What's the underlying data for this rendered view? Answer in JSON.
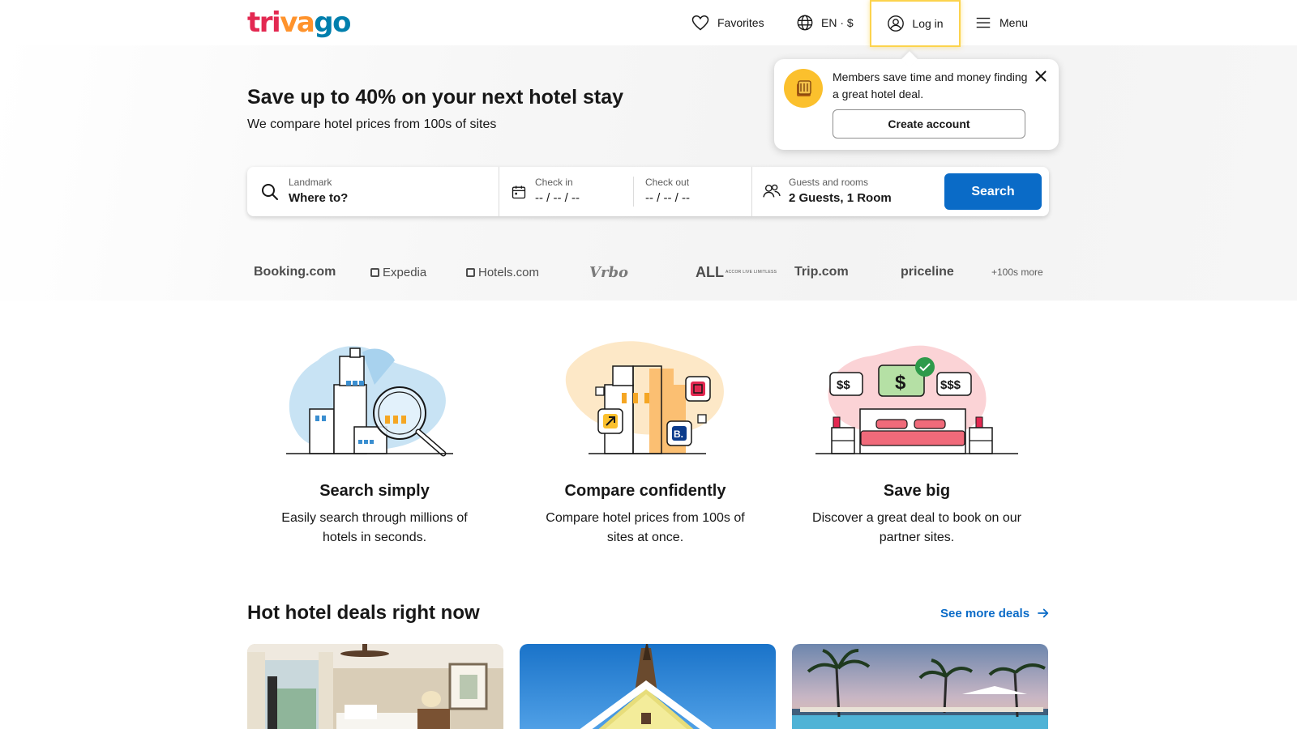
{
  "header": {
    "logo": {
      "part1": "tri",
      "part2": "va",
      "part3": "go"
    },
    "favorites_label": "Favorites",
    "language_label": "EN · $",
    "login_label": "Log in",
    "menu_label": "Menu"
  },
  "popover": {
    "message": "Members save time and money finding a great hotel deal.",
    "create_account_label": "Create account"
  },
  "hero": {
    "title": "Save up to 40% on your next hotel stay",
    "subtitle": "We compare hotel prices from 100s of sites"
  },
  "search": {
    "destination_label": "Landmark",
    "destination_placeholder": "Where to?",
    "checkin_label": "Check in",
    "checkin_value": "-- / -- / --",
    "checkout_label": "Check out",
    "checkout_value": "-- / -- / --",
    "guests_label": "Guests and rooms",
    "guests_value": "2 Guests, 1 Room",
    "button_label": "Search"
  },
  "partners": {
    "booking": "Booking.com",
    "expedia": "Expedia",
    "hotels": "Hotels.com",
    "vrbo": "Vrbo",
    "all": "ALL",
    "all_tagline": "ACCOR LIVE LIMITLESS",
    "trip": "Trip.com",
    "priceline": "priceline",
    "more": "+100s more"
  },
  "features": [
    {
      "title": "Search simply",
      "description": "Easily search through millions of hotels in seconds."
    },
    {
      "title": "Compare confidently",
      "description": "Compare hotel prices from 100s of sites at once."
    },
    {
      "title": "Save big",
      "description": "Discover a great deal to book on our partner sites."
    }
  ],
  "illustration_text": {
    "price_low": "$$",
    "price_mid": "$",
    "price_high": "$$$",
    "booking_badge": "B."
  },
  "deals": {
    "title": "Hot hotel deals right now",
    "see_more_label": "See more deals"
  },
  "colors": {
    "brand_red": "#e32851",
    "brand_orange": "#ff932c",
    "brand_blue": "#007fad",
    "search_button": "#0a6bc7",
    "link_blue": "#0a6bc7",
    "login_highlight": "#fcd34d"
  }
}
